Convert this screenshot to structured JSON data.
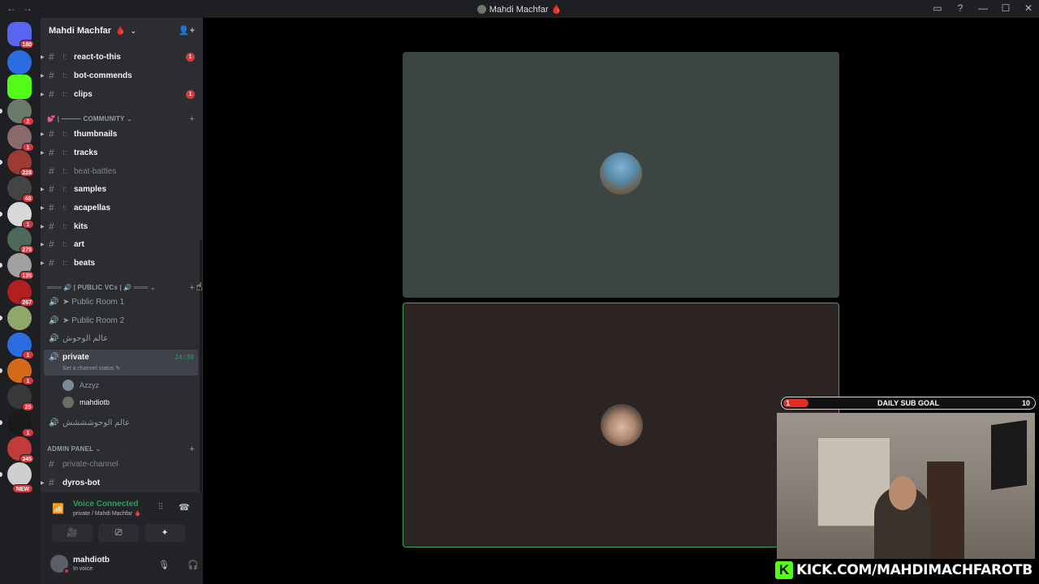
{
  "window": {
    "title": "Mahdi Machfar 🩸",
    "back": "←",
    "forward": "→",
    "controls": [
      "▭",
      "?",
      "—",
      "☐",
      "✕"
    ]
  },
  "guilds": [
    {
      "badge": "180",
      "color": "#5865f2"
    },
    {
      "badge": "",
      "color": "#2b6de0"
    },
    {
      "badge": "",
      "color": "#53fc18"
    },
    {
      "badge": "2",
      "color": "#6a7b6a"
    },
    {
      "badge": "1",
      "color": "#8a6a6a"
    },
    {
      "badge": "228",
      "color": "#9c3b32"
    },
    {
      "badge": "48",
      "color": "#444"
    },
    {
      "badge": "1",
      "color": "#d8d8d8"
    },
    {
      "badge": "275",
      "color": "#4c6a5a"
    },
    {
      "badge": "135",
      "color": "#a0a0a0"
    },
    {
      "badge": "267",
      "color": "#b31e1e"
    },
    {
      "badge": "",
      "color": "#8fa86a"
    },
    {
      "badge": "1",
      "color": "#2b6de0"
    },
    {
      "badge": "1",
      "color": "#d66a1a"
    },
    {
      "badge": "25",
      "color": "#3a3a3a"
    },
    {
      "badge": "1",
      "color": "#1a1a1a"
    },
    {
      "badge": "345",
      "color": "#c23a3a"
    },
    {
      "badge": "NEW",
      "color": "#cfcfcf"
    }
  ],
  "server": {
    "name": "Mahdi Machfar",
    "flame": "🩸",
    "chevron": "⌄",
    "invite_icon": "👤+"
  },
  "channels_top": [
    {
      "name": "react-to-this",
      "unread": "1",
      "muted": false
    },
    {
      "name": "bot-commends",
      "unread": "",
      "muted": false
    },
    {
      "name": "clips",
      "unread": "1",
      "muted": false
    }
  ],
  "community_category": "💕 | ――― COMMUNITY ⌄",
  "channels_community": [
    {
      "name": "thumbnails",
      "muted": false
    },
    {
      "name": "tracks",
      "muted": false
    },
    {
      "name": "beat-battles",
      "muted": true
    },
    {
      "name": "samples",
      "muted": false
    },
    {
      "name": "acapellas",
      "muted": false
    },
    {
      "name": "kits",
      "muted": false
    },
    {
      "name": "art",
      "muted": false
    },
    {
      "name": "beats",
      "muted": false
    }
  ],
  "vc_category": "═══ 🔊 | PUBLIC VCs | 🔊 ═══ ⌄",
  "voice_channels": [
    {
      "name": "➤ Public Room 1"
    },
    {
      "name": "➤ Public Room 2"
    },
    {
      "name": "عالم الوحوش"
    }
  ],
  "private_channel": {
    "name": "private",
    "time": "24:39",
    "status": "Set a channel status ✎"
  },
  "members": [
    {
      "name": "Azzyz",
      "color": "#949ba4",
      "ava": "#7b8a9a"
    },
    {
      "name": "mahdiotb",
      "color": "#f2f3f5",
      "ava": "#6a6f66"
    }
  ],
  "voice_channel_extra": {
    "name": "عالم الوحوشششش"
  },
  "admin_category": "ADMIN PANEL ⌄",
  "admin_channels": [
    {
      "name": "private-channel",
      "muted": true
    },
    {
      "name": "dyros-bot",
      "muted": false
    }
  ],
  "voice_panel": {
    "title": "Voice Connected",
    "subtitle": "private / Mahdi Machfar 🩸",
    "buttons": [
      "🎥",
      "⎚",
      "✦",
      "✧"
    ]
  },
  "user": {
    "name": "mahdiotb",
    "status": "In voice"
  },
  "sub_goal": {
    "current": "1",
    "label": "DAILY SUB GOAL",
    "target": "10",
    "progress": 0.1
  },
  "overlay": {
    "kick_text": "KICK.COM/MAHDIMACHFAROTB"
  }
}
